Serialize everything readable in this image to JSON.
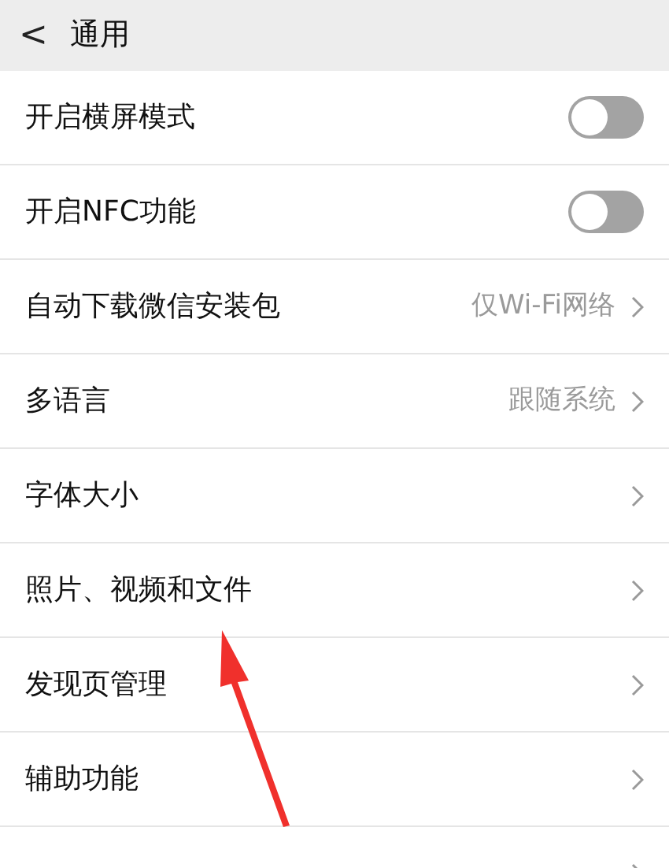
{
  "header": {
    "back": "<",
    "title": "通用"
  },
  "items": [
    {
      "kind": "toggle",
      "label": "开启横屏模式",
      "on": false
    },
    {
      "kind": "toggle",
      "label": "开启NFC功能",
      "on": false
    },
    {
      "kind": "link",
      "label": "自动下载微信安装包",
      "value": "仅Wi-Fi网络"
    },
    {
      "kind": "link",
      "label": "多语言",
      "value": "跟随系统"
    },
    {
      "kind": "link",
      "label": "字体大小"
    },
    {
      "kind": "link",
      "label": "照片、视频和文件"
    },
    {
      "kind": "link",
      "label": "发现页管理"
    },
    {
      "kind": "link",
      "label": "辅助功能"
    },
    {
      "kind": "link"
    }
  ]
}
